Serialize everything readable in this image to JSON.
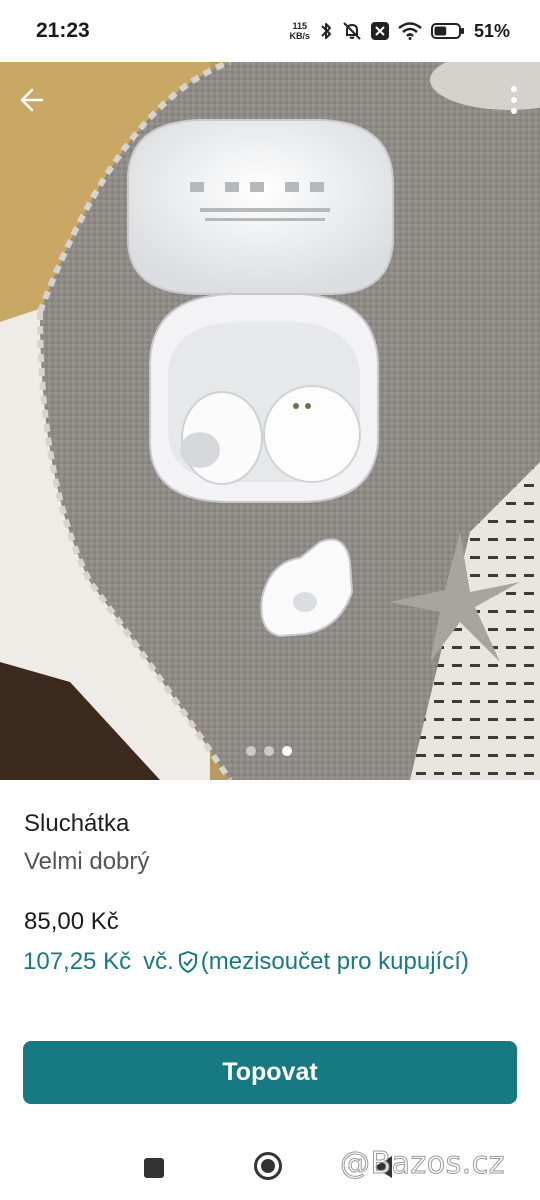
{
  "status_bar": {
    "time": "21:23",
    "net_speed_value": "115",
    "net_speed_unit": "KB/s",
    "battery_level": 0.51,
    "battery_text": "51%"
  },
  "gallery": {
    "image_count": 3,
    "active_index": 2
  },
  "listing": {
    "title": "Sluchátka",
    "condition": "Velmi dobrý",
    "price": "85,00 Kč",
    "buyer_price": "107,25 Kč",
    "buyer_price_incl": "vč.",
    "buyer_price_note": "(mezisoučet pro kupující)"
  },
  "actions": {
    "promote_label": "Topovat"
  },
  "watermark": {
    "text": "@Bazos.cz"
  },
  "colors": {
    "accent": "#177a83",
    "text_primary": "#1f1f1f",
    "text_secondary": "#555555"
  },
  "icons": {
    "back": "arrow-left-icon",
    "more": "more-vertical-icon",
    "shield": "shield-check-icon",
    "bluetooth": "bluetooth-icon",
    "mute": "bell-off-icon",
    "notification": "x-box-icon",
    "wifi": "wifi-icon",
    "battery": "battery-icon"
  }
}
